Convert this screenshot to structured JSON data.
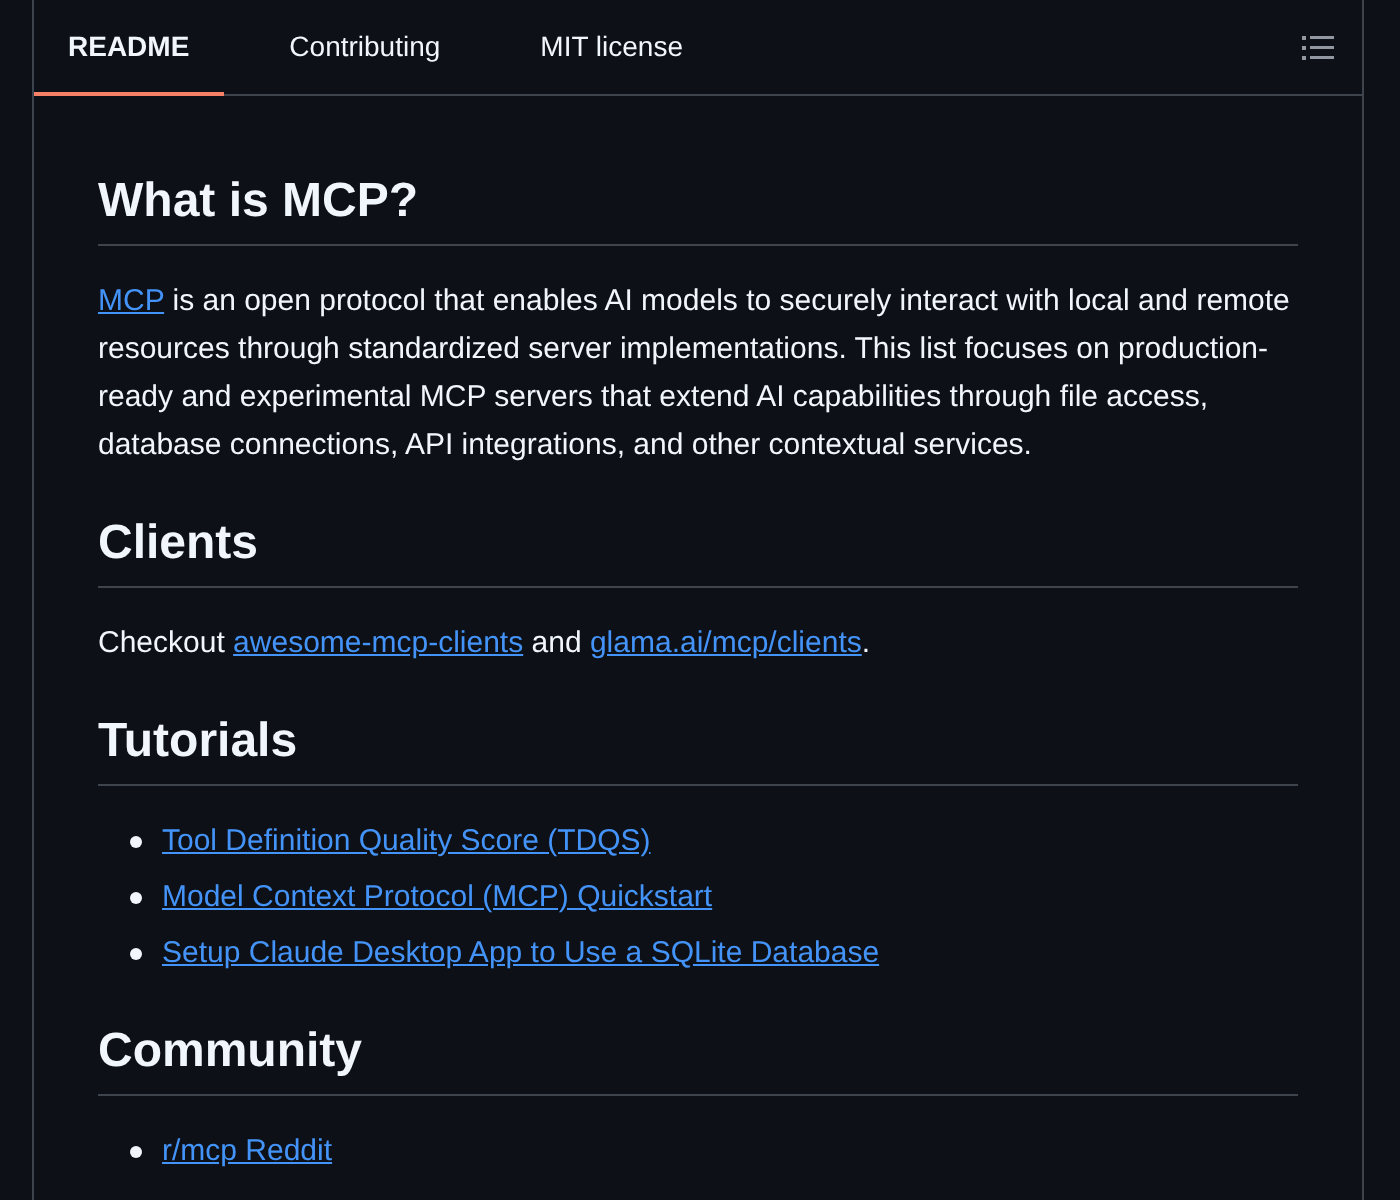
{
  "tabs": [
    {
      "label": "README",
      "selected": true
    },
    {
      "label": "Contributing",
      "selected": false
    },
    {
      "label": "MIT license",
      "selected": false
    }
  ],
  "sections": [
    {
      "heading": "What is MCP?",
      "kind": "paragraph",
      "parts": [
        {
          "kind": "link",
          "text": "MCP"
        },
        {
          "kind": "text",
          "text": " is an open protocol that enables AI models to securely interact with local and remote resources through standardized server implementations. This list focuses on production-ready and experimental MCP servers that extend AI capabilities through file access, database connections, API integrations, and other contextual services."
        }
      ]
    },
    {
      "heading": "Clients",
      "kind": "paragraph",
      "parts": [
        {
          "kind": "text",
          "text": "Checkout "
        },
        {
          "kind": "link",
          "text": "awesome-mcp-clients"
        },
        {
          "kind": "text",
          "text": " and "
        },
        {
          "kind": "link",
          "text": "glama.ai/mcp/clients"
        },
        {
          "kind": "text",
          "text": "."
        }
      ]
    },
    {
      "heading": "Tutorials",
      "kind": "list",
      "items": [
        "Tool Definition Quality Score (TDQS)",
        "Model Context Protocol (MCP) Quickstart",
        "Setup Claude Desktop App to Use a SQLite Database"
      ]
    },
    {
      "heading": "Community",
      "kind": "list",
      "items": [
        "r/mcp Reddit"
      ]
    }
  ]
}
